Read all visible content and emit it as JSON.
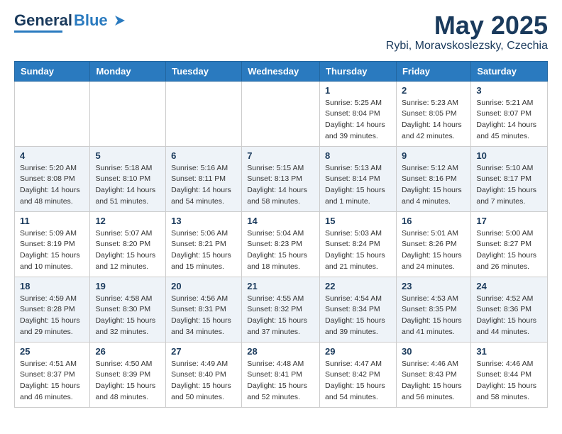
{
  "header": {
    "logo_general": "General",
    "logo_blue": "Blue",
    "title": "May 2025",
    "location": "Rybi, Moravskoslezsky, Czechia"
  },
  "weekdays": [
    "Sunday",
    "Monday",
    "Tuesday",
    "Wednesday",
    "Thursday",
    "Friday",
    "Saturday"
  ],
  "weeks": [
    [
      {
        "day": "",
        "info": ""
      },
      {
        "day": "",
        "info": ""
      },
      {
        "day": "",
        "info": ""
      },
      {
        "day": "",
        "info": ""
      },
      {
        "day": "1",
        "info": "Sunrise: 5:25 AM\nSunset: 8:04 PM\nDaylight: 14 hours\nand 39 minutes."
      },
      {
        "day": "2",
        "info": "Sunrise: 5:23 AM\nSunset: 8:05 PM\nDaylight: 14 hours\nand 42 minutes."
      },
      {
        "day": "3",
        "info": "Sunrise: 5:21 AM\nSunset: 8:07 PM\nDaylight: 14 hours\nand 45 minutes."
      }
    ],
    [
      {
        "day": "4",
        "info": "Sunrise: 5:20 AM\nSunset: 8:08 PM\nDaylight: 14 hours\nand 48 minutes."
      },
      {
        "day": "5",
        "info": "Sunrise: 5:18 AM\nSunset: 8:10 PM\nDaylight: 14 hours\nand 51 minutes."
      },
      {
        "day": "6",
        "info": "Sunrise: 5:16 AM\nSunset: 8:11 PM\nDaylight: 14 hours\nand 54 minutes."
      },
      {
        "day": "7",
        "info": "Sunrise: 5:15 AM\nSunset: 8:13 PM\nDaylight: 14 hours\nand 58 minutes."
      },
      {
        "day": "8",
        "info": "Sunrise: 5:13 AM\nSunset: 8:14 PM\nDaylight: 15 hours\nand 1 minute."
      },
      {
        "day": "9",
        "info": "Sunrise: 5:12 AM\nSunset: 8:16 PM\nDaylight: 15 hours\nand 4 minutes."
      },
      {
        "day": "10",
        "info": "Sunrise: 5:10 AM\nSunset: 8:17 PM\nDaylight: 15 hours\nand 7 minutes."
      }
    ],
    [
      {
        "day": "11",
        "info": "Sunrise: 5:09 AM\nSunset: 8:19 PM\nDaylight: 15 hours\nand 10 minutes."
      },
      {
        "day": "12",
        "info": "Sunrise: 5:07 AM\nSunset: 8:20 PM\nDaylight: 15 hours\nand 12 minutes."
      },
      {
        "day": "13",
        "info": "Sunrise: 5:06 AM\nSunset: 8:21 PM\nDaylight: 15 hours\nand 15 minutes."
      },
      {
        "day": "14",
        "info": "Sunrise: 5:04 AM\nSunset: 8:23 PM\nDaylight: 15 hours\nand 18 minutes."
      },
      {
        "day": "15",
        "info": "Sunrise: 5:03 AM\nSunset: 8:24 PM\nDaylight: 15 hours\nand 21 minutes."
      },
      {
        "day": "16",
        "info": "Sunrise: 5:01 AM\nSunset: 8:26 PM\nDaylight: 15 hours\nand 24 minutes."
      },
      {
        "day": "17",
        "info": "Sunrise: 5:00 AM\nSunset: 8:27 PM\nDaylight: 15 hours\nand 26 minutes."
      }
    ],
    [
      {
        "day": "18",
        "info": "Sunrise: 4:59 AM\nSunset: 8:28 PM\nDaylight: 15 hours\nand 29 minutes."
      },
      {
        "day": "19",
        "info": "Sunrise: 4:58 AM\nSunset: 8:30 PM\nDaylight: 15 hours\nand 32 minutes."
      },
      {
        "day": "20",
        "info": "Sunrise: 4:56 AM\nSunset: 8:31 PM\nDaylight: 15 hours\nand 34 minutes."
      },
      {
        "day": "21",
        "info": "Sunrise: 4:55 AM\nSunset: 8:32 PM\nDaylight: 15 hours\nand 37 minutes."
      },
      {
        "day": "22",
        "info": "Sunrise: 4:54 AM\nSunset: 8:34 PM\nDaylight: 15 hours\nand 39 minutes."
      },
      {
        "day": "23",
        "info": "Sunrise: 4:53 AM\nSunset: 8:35 PM\nDaylight: 15 hours\nand 41 minutes."
      },
      {
        "day": "24",
        "info": "Sunrise: 4:52 AM\nSunset: 8:36 PM\nDaylight: 15 hours\nand 44 minutes."
      }
    ],
    [
      {
        "day": "25",
        "info": "Sunrise: 4:51 AM\nSunset: 8:37 PM\nDaylight: 15 hours\nand 46 minutes."
      },
      {
        "day": "26",
        "info": "Sunrise: 4:50 AM\nSunset: 8:39 PM\nDaylight: 15 hours\nand 48 minutes."
      },
      {
        "day": "27",
        "info": "Sunrise: 4:49 AM\nSunset: 8:40 PM\nDaylight: 15 hours\nand 50 minutes."
      },
      {
        "day": "28",
        "info": "Sunrise: 4:48 AM\nSunset: 8:41 PM\nDaylight: 15 hours\nand 52 minutes."
      },
      {
        "day": "29",
        "info": "Sunrise: 4:47 AM\nSunset: 8:42 PM\nDaylight: 15 hours\nand 54 minutes."
      },
      {
        "day": "30",
        "info": "Sunrise: 4:46 AM\nSunset: 8:43 PM\nDaylight: 15 hours\nand 56 minutes."
      },
      {
        "day": "31",
        "info": "Sunrise: 4:46 AM\nSunset: 8:44 PM\nDaylight: 15 hours\nand 58 minutes."
      }
    ]
  ]
}
